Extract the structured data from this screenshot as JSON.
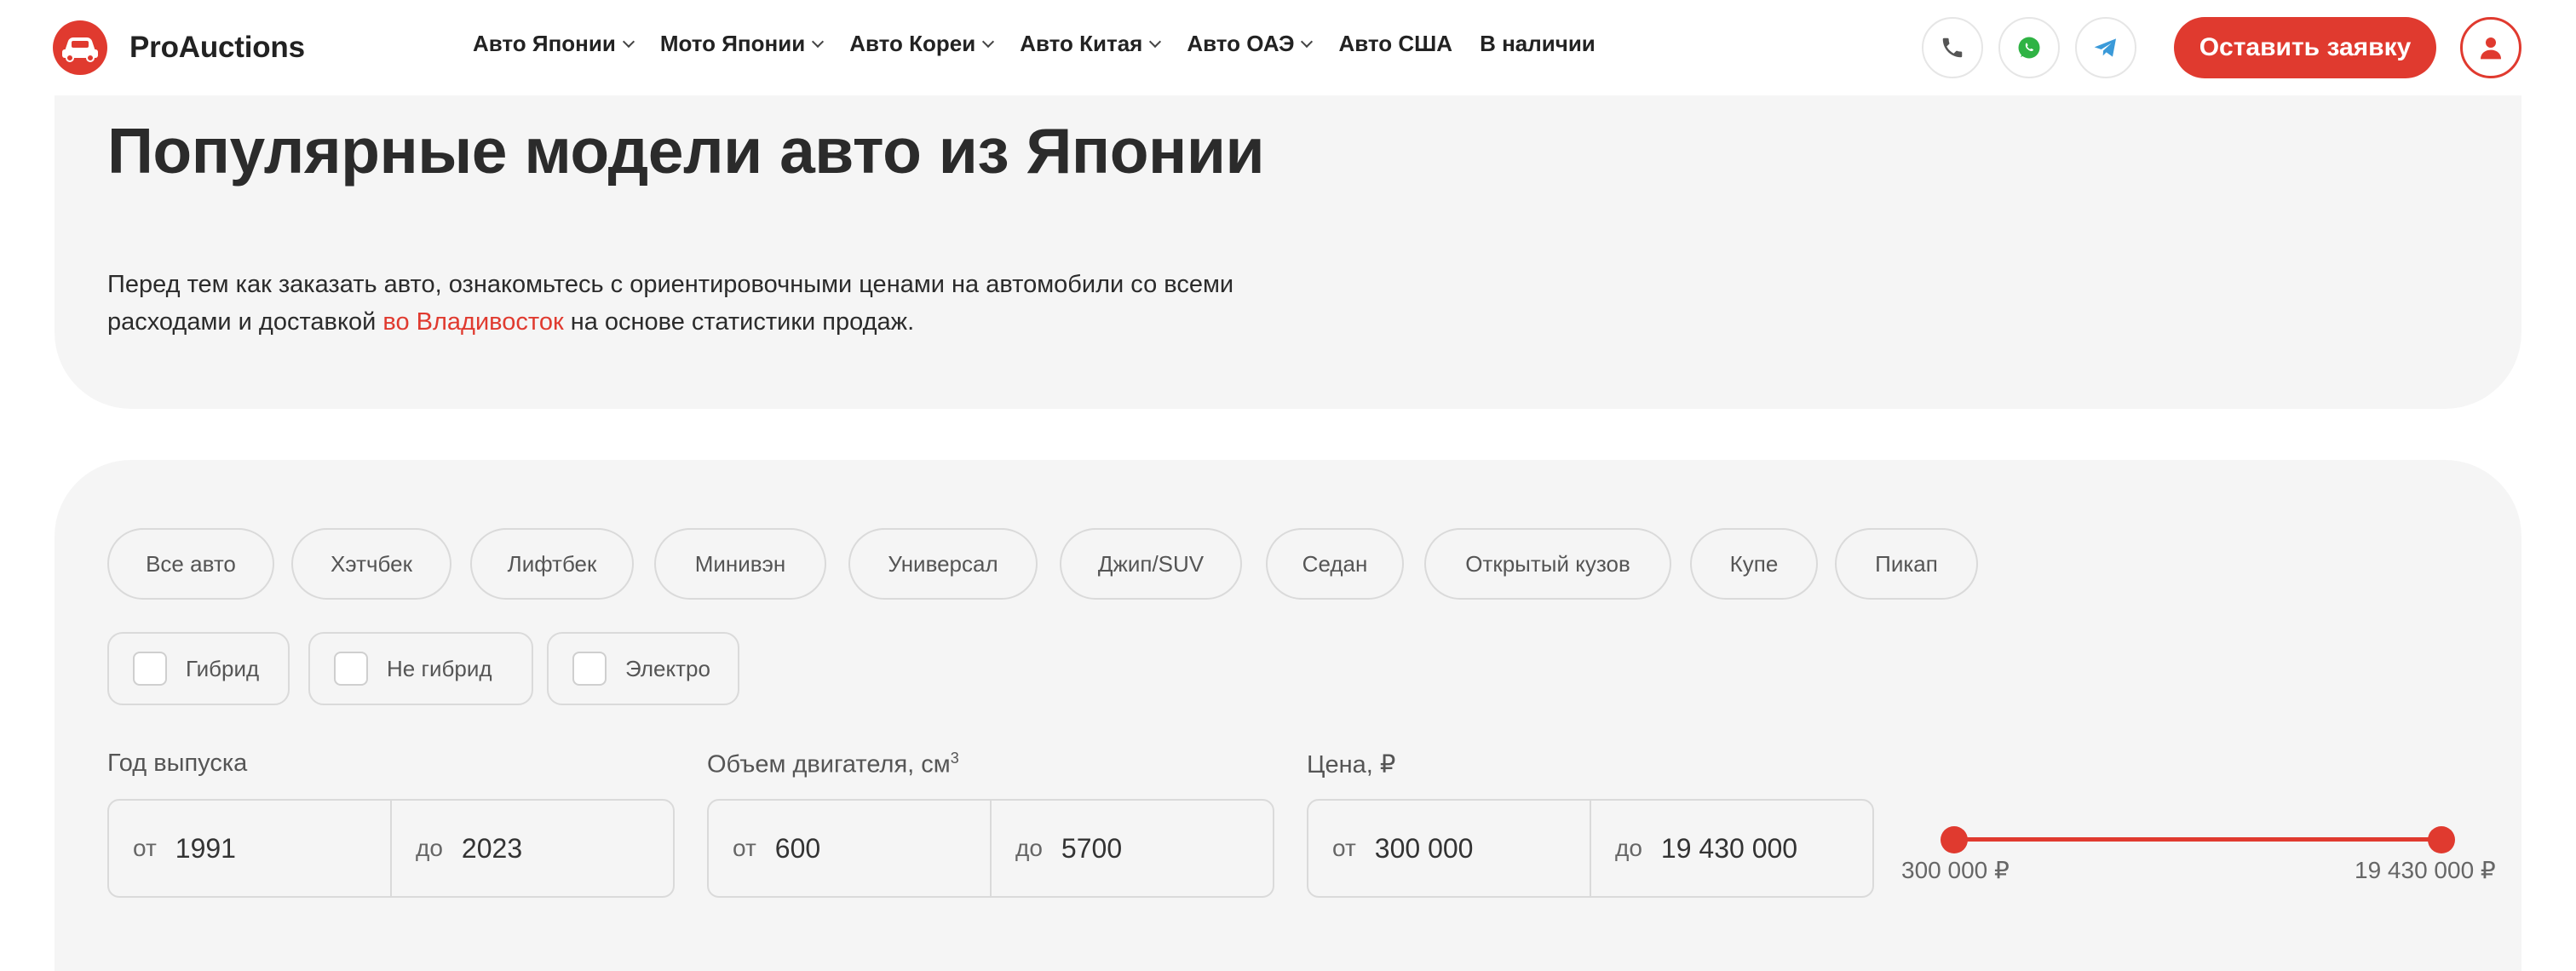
{
  "header": {
    "logo_text": "ProAuctions",
    "nav": [
      {
        "label": "Авто Японии",
        "has_dropdown": true
      },
      {
        "label": "Мото Японии",
        "has_dropdown": true
      },
      {
        "label": "Авто Кореи",
        "has_dropdown": true
      },
      {
        "label": "Авто Китая",
        "has_dropdown": true
      },
      {
        "label": "Авто ОАЭ",
        "has_dropdown": true
      },
      {
        "label": "Авто США",
        "has_dropdown": false
      },
      {
        "label": "В наличии",
        "has_dropdown": false
      }
    ],
    "icons": [
      "phone-icon",
      "whatsapp-icon",
      "telegram-icon",
      "user-icon"
    ],
    "cta_label": "Оставить заявку"
  },
  "hero": {
    "title": "Популярные модели авто из Японии",
    "desc_line1": "Перед тем как заказать авто, ознакомьтесь с ориентировочными ценами на автомобили со всеми",
    "desc_line2_pre": "расходами и доставкой ",
    "desc_link": "во Владивосток",
    "desc_line2_post": " на основе статистики продаж."
  },
  "filters": {
    "body_types": [
      "Все авто",
      "Хэтчбек",
      "Лифтбек",
      "Минивэн",
      "Универсал",
      "Джип/SUV",
      "Седан",
      "Открытый кузов",
      "Купе",
      "Пикап"
    ],
    "fuel_types": [
      "Гибрид",
      "Не гибрид",
      "Электро"
    ],
    "year": {
      "label": "Год выпуска",
      "from_prefix": "от",
      "from": "1991",
      "to_prefix": "до",
      "to": "2023"
    },
    "engine": {
      "label": "Объем двигателя, см",
      "label_sup": "3",
      "from_prefix": "от",
      "from": "600",
      "to_prefix": "до",
      "to": "5700"
    },
    "price": {
      "label": "Цена, ₽",
      "from_prefix": "от",
      "from": "300 000",
      "to_prefix": "до",
      "to": "19 430 000"
    },
    "price_slider": {
      "min_label": "300 000 ₽",
      "max_label": "19 430 000 ₽"
    }
  },
  "colors": {
    "accent": "#e03a2f",
    "panel": "#f5f5f5"
  }
}
